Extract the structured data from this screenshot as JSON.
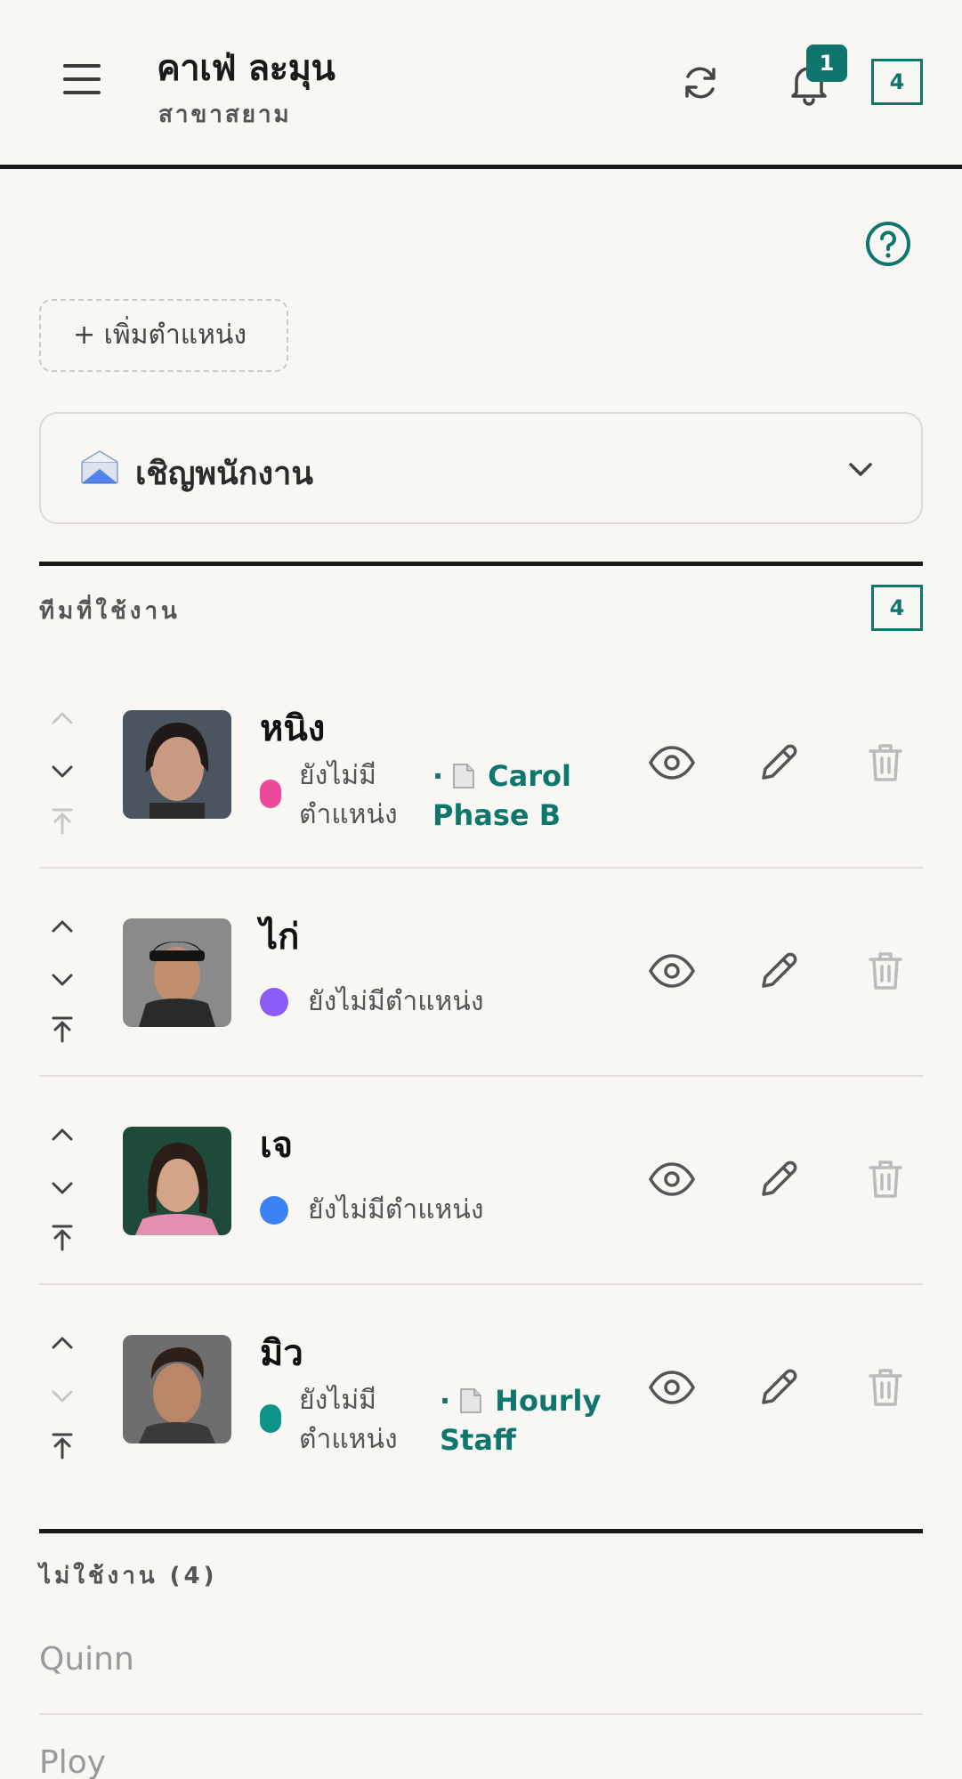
{
  "header": {
    "store_name": "คาเฟ่ ละมุน",
    "branch_name": "สาขาสยาม",
    "notification_count": "1",
    "staff_count": "4"
  },
  "actions": {
    "add_position_label": "+ เพิ่มตำแหน่ง",
    "invite_label": "เชิญพนักงาน"
  },
  "active_team": {
    "label": "ทีมที่ใช้งาน",
    "count": "4",
    "members": [
      {
        "name": "หนิง",
        "status_line1": "ยังไม่มี",
        "status_line2": "ตำแหน่ง",
        "contract_line1": "Carol",
        "contract_line2": "Phase B",
        "color": "#ec4899"
      },
      {
        "name": "ไก่",
        "status": "ยังไม่มีตำแหน่ง",
        "color": "#8b5cf6"
      },
      {
        "name": "เจ",
        "status": "ยังไม่มีตำแหน่ง",
        "color": "#3b82f6"
      },
      {
        "name": "มิว",
        "status_line1": "ยังไม่มี",
        "status_line2": "ตำแหน่ง",
        "contract_line1": "Hourly",
        "contract_line2": "Staff",
        "color": "#0d9488"
      }
    ]
  },
  "inactive_team": {
    "label": "ไม่ใช้งาน (4)",
    "members": [
      {
        "name": "Quinn"
      },
      {
        "name": "Ploy"
      }
    ]
  },
  "icons": {
    "menu": "menu-icon",
    "refresh": "refresh-icon",
    "notifications": "bell-icon",
    "help": "help-circle-icon",
    "invite": "envelope-icon",
    "view": "eye-icon",
    "edit": "pencil-icon",
    "delete": "trash-icon"
  },
  "colors": {
    "accent": "#0f766e",
    "background": "#f8f7f4"
  }
}
